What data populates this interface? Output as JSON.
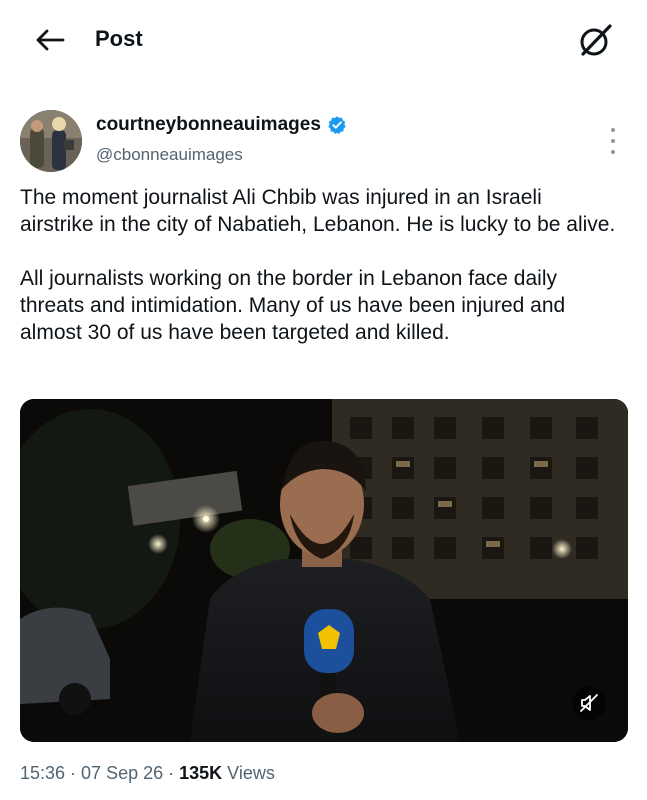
{
  "header": {
    "title": "Post",
    "back_icon": "arrow-left-icon",
    "right_icon": "grok-icon"
  },
  "author": {
    "display_name": "courtneybonneauimages",
    "handle": "@cbonneauimages",
    "verified": true,
    "verified_color": "#1d9bf0"
  },
  "post": {
    "paragraphs": [
      "The moment journalist Ali Chbib was injured in an Israeli airstrike in the city of Nabatieh, Lebanon. He is lucky to be alive.",
      "All journalists working on the border in Lebanon face daily threats and intimidation. Many of us have been injured and almost 30 of us have been targeted and killed."
    ],
    "media": {
      "type": "video",
      "muted_icon": "speaker-muted-icon"
    },
    "time": "15:36",
    "separator": "·",
    "date": "07 Sep 26",
    "views_count": "135K",
    "views_label": "Views"
  }
}
